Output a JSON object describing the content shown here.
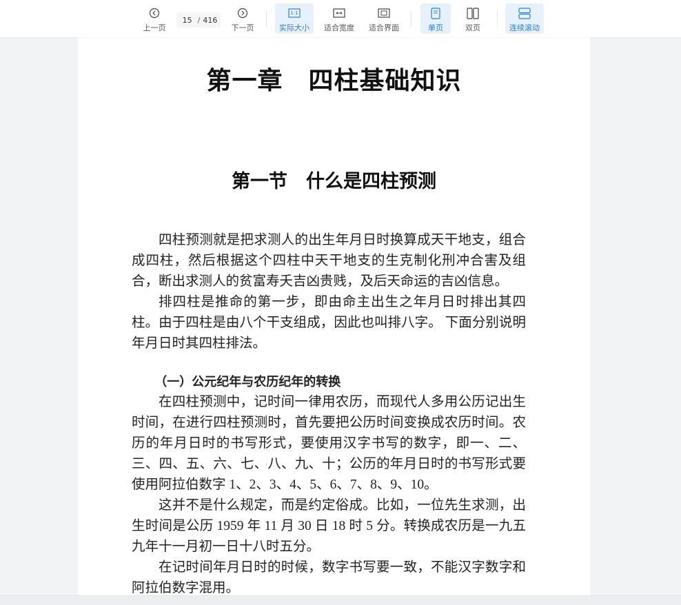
{
  "toolbar": {
    "prev_label": "上一页",
    "next_label": "下一页",
    "page_current": "15",
    "page_separator": "/",
    "page_total": "416",
    "actual_size_label": "实际大小",
    "actual_size_glyph": "1:1",
    "fit_width_label": "适合宽度",
    "fit_page_label": "适合界面",
    "single_page_label": "单页",
    "double_page_label": "双页",
    "continuous_label": "连续滚动",
    "active_modes": [
      "actual_size",
      "single_page",
      "continuous"
    ],
    "icons": {
      "prev": "chevron-left-circle-icon",
      "next": "chevron-right-circle-icon",
      "actual_size": "actual-size-icon",
      "fit_width": "fit-width-icon",
      "fit_page": "fit-page-icon",
      "single_page": "single-page-icon",
      "double_page": "double-page-icon",
      "continuous": "continuous-scroll-icon"
    },
    "accent_color": "#2b7ed6",
    "active_bg_color": "#e6f1fb"
  },
  "document": {
    "chapter_title": "第一章　四柱基础知识",
    "section_title": "第一节　什么是四柱预测",
    "paragraphs": [
      "四柱预测就是把求测人的出生年月日时换算成天干地支，组合成四柱，然后根据这个四柱中天干地支的生克制化刑冲合害及组合，断出求测人的贫富寿夭吉凶贵贱，及后天命运的吉凶信息。",
      "排四柱是推命的第一步，即由命主出生之年月日时排出其四柱。由于四柱是由八个干支组成，因此也叫排八字。 下面分别说明年月日时其四柱排法。"
    ],
    "subheading": "（一）公元纪年与农历纪年的转换",
    "paragraphs2": [
      "在四柱预测中，记时间一律用农历，而现代人多用公历记出生时间，在进行四柱预测时，首先要把公历时间变换成农历时间。农历的年月日时的书写形式，要使用汉字书写的数字，即一、二、三、四、五、六、七、八、九、十；公历的年月日时的书写形式要使用阿拉伯数字 1、2、3、4、5、6、7、8、9、10。",
      "这并不是什么规定，而是约定俗成。比如，一位先生求测，出生时间是公历 1959 年 11 月 30 日 18 时 5 分。转换成农历是一九五九年十一月初一日十八时五分。",
      "在记时间年月日时的时候，数字书写要一致，不能汉字数字和阿拉伯数字混用。"
    ]
  }
}
